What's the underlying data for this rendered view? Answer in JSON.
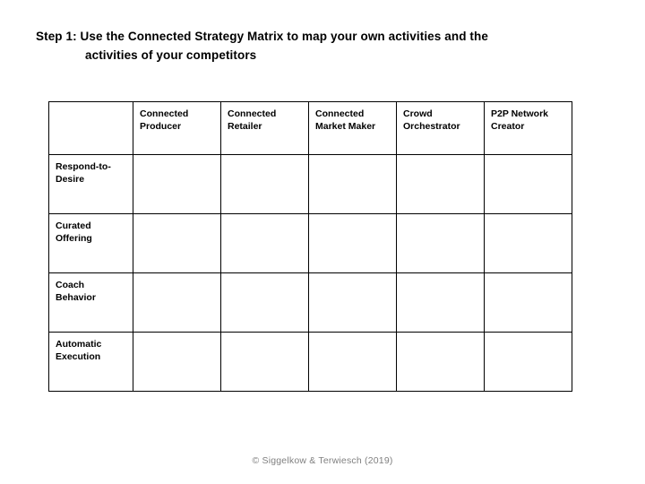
{
  "slide": {
    "title_line_1": "Step 1: Use the Connected Strategy Matrix to map your own activities and the",
    "title_line_2": "activities of your competitors",
    "footer": "© Siggelkow & Terwiesch (2019)"
  },
  "matrix": {
    "corner_label": "",
    "column_headers": [
      "Connected\nProducer",
      "Connected\nRetailer",
      "Connected\nMarket Maker",
      "Crowd\nOrchestrator",
      "P2P Network\nCreator"
    ],
    "rows": [
      {
        "label": "Respond-to-\nDesire",
        "cells": [
          "",
          "",
          "",
          "",
          ""
        ]
      },
      {
        "label": "Curated\nOffering",
        "cells": [
          "",
          "",
          "",
          "",
          ""
        ]
      },
      {
        "label": "Coach\nBehavior",
        "cells": [
          "",
          "",
          "",
          "",
          ""
        ]
      },
      {
        "label": "Automatic\nExecution",
        "cells": [
          "",
          "",
          "",
          "",
          ""
        ]
      }
    ]
  }
}
